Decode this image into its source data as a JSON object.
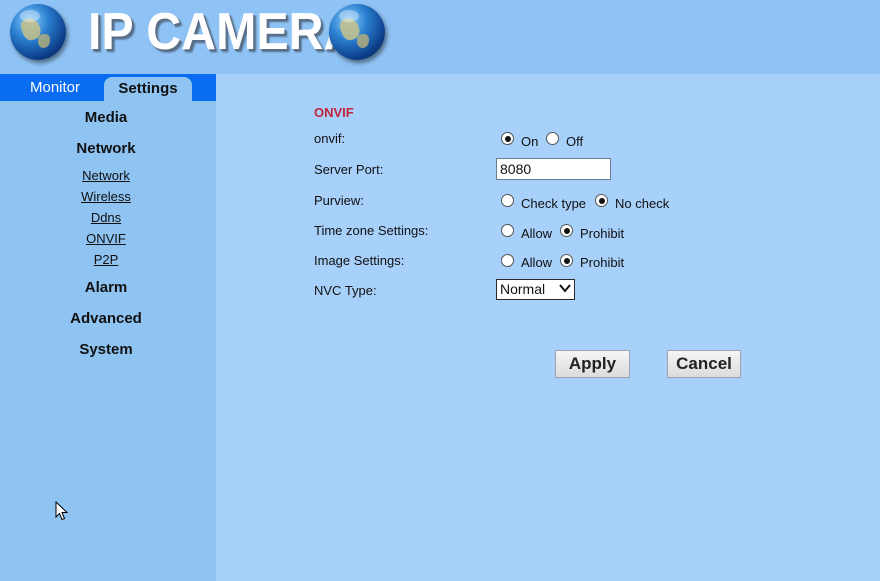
{
  "header": {
    "title": "IP CAMERA"
  },
  "tabs": [
    {
      "label": "Monitor"
    },
    {
      "label": "Settings"
    }
  ],
  "sidebar": {
    "sections": [
      {
        "label": "Media"
      },
      {
        "label": "Network",
        "items": [
          "Network",
          "Wireless",
          "Ddns",
          "ONVIF",
          "P2P"
        ]
      },
      {
        "label": "Alarm"
      },
      {
        "label": "Advanced"
      },
      {
        "label": "System"
      }
    ]
  },
  "form": {
    "title": "ONVIF",
    "onvif": {
      "label": "onvif:",
      "options": [
        "On",
        "Off"
      ],
      "selected": "On"
    },
    "server_port": {
      "label": "Server Port:",
      "value": "8080"
    },
    "purview": {
      "label": "Purview:",
      "options": [
        "Check type",
        "No check"
      ],
      "selected": "No check"
    },
    "time_zone": {
      "label": "Time zone Settings:",
      "options": [
        "Allow",
        "Prohibit"
      ],
      "selected": "Prohibit"
    },
    "image_settings": {
      "label": "Image Settings:",
      "options": [
        "Allow",
        "Prohibit"
      ],
      "selected": "Prohibit"
    },
    "nvc_type": {
      "label": "NVC Type:",
      "value": "Normal"
    },
    "apply_label": "Apply",
    "cancel_label": "Cancel"
  },
  "icons": {
    "logo_left": "globe-icon",
    "logo_right": "globe-icon",
    "dropdown": "chevron-down-icon",
    "pointer": "cursor-icon"
  }
}
